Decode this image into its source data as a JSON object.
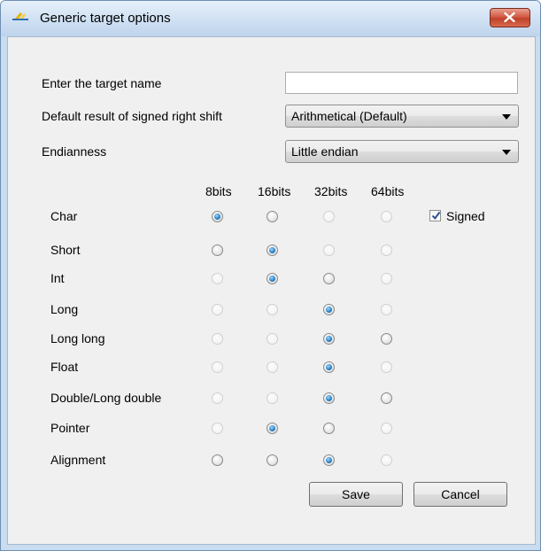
{
  "window": {
    "title": "Generic target options"
  },
  "form": {
    "target_name_label": "Enter the target name",
    "target_name_value": "",
    "shift_label": "Default result of signed right shift",
    "shift_value": "Arithmetical (Default)",
    "endianness_label": "Endianness",
    "endianness_value": "Little endian"
  },
  "grid": {
    "columns": [
      "8bits",
      "16bits",
      "32bits",
      "64bits"
    ],
    "rows": [
      {
        "label": "Char",
        "cells": [
          {
            "enabled": true,
            "selected": true
          },
          {
            "enabled": true,
            "selected": false
          },
          {
            "enabled": false,
            "selected": false
          },
          {
            "enabled": false,
            "selected": false
          }
        ]
      },
      {
        "label": "Short",
        "cells": [
          {
            "enabled": true,
            "selected": false
          },
          {
            "enabled": true,
            "selected": true
          },
          {
            "enabled": false,
            "selected": false
          },
          {
            "enabled": false,
            "selected": false
          }
        ]
      },
      {
        "label": "Int",
        "cells": [
          {
            "enabled": false,
            "selected": false
          },
          {
            "enabled": true,
            "selected": true
          },
          {
            "enabled": true,
            "selected": false
          },
          {
            "enabled": false,
            "selected": false
          }
        ]
      },
      {
        "label": "Long",
        "cells": [
          {
            "enabled": false,
            "selected": false
          },
          {
            "enabled": false,
            "selected": false
          },
          {
            "enabled": true,
            "selected": true
          },
          {
            "enabled": false,
            "selected": false
          }
        ]
      },
      {
        "label": "Long long",
        "cells": [
          {
            "enabled": false,
            "selected": false
          },
          {
            "enabled": false,
            "selected": false
          },
          {
            "enabled": true,
            "selected": true
          },
          {
            "enabled": true,
            "selected": false
          }
        ]
      },
      {
        "label": "Float",
        "cells": [
          {
            "enabled": false,
            "selected": false
          },
          {
            "enabled": false,
            "selected": false
          },
          {
            "enabled": true,
            "selected": true
          },
          {
            "enabled": false,
            "selected": false
          }
        ]
      },
      {
        "label": "Double/Long double",
        "cells": [
          {
            "enabled": false,
            "selected": false
          },
          {
            "enabled": false,
            "selected": false
          },
          {
            "enabled": true,
            "selected": true
          },
          {
            "enabled": true,
            "selected": false
          }
        ]
      },
      {
        "label": "Pointer",
        "cells": [
          {
            "enabled": false,
            "selected": false
          },
          {
            "enabled": true,
            "selected": true
          },
          {
            "enabled": true,
            "selected": false
          },
          {
            "enabled": false,
            "selected": false
          }
        ]
      },
      {
        "label": "Alignment",
        "cells": [
          {
            "enabled": true,
            "selected": false
          },
          {
            "enabled": true,
            "selected": false
          },
          {
            "enabled": true,
            "selected": true
          },
          {
            "enabled": false,
            "selected": false
          }
        ]
      }
    ],
    "signed_label": "Signed",
    "signed_checked": true
  },
  "buttons": {
    "save": "Save",
    "cancel": "Cancel"
  }
}
